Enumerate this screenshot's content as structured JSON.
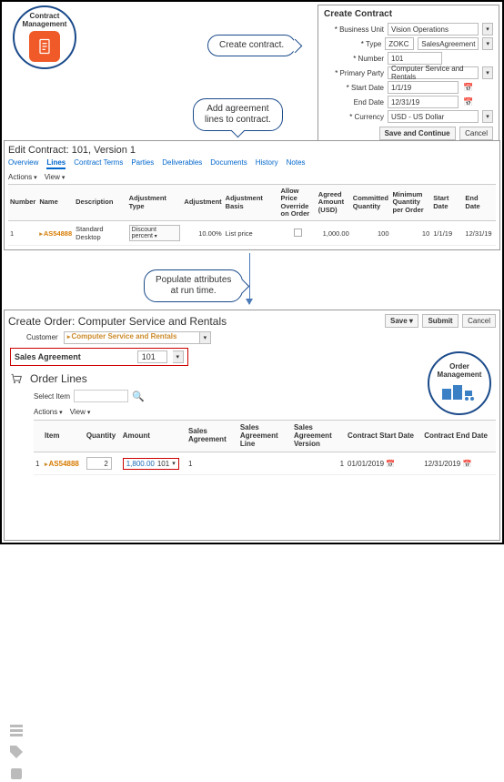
{
  "badges": {
    "contract_mgmt": "Contract Management",
    "order_mgmt": "Order Management"
  },
  "callouts": {
    "create": "Create contract.",
    "add_lines": "Add agreement\nlines to contract.",
    "populate": "Populate attributes\nat run time."
  },
  "dialog": {
    "title": "Create Contract",
    "fields": {
      "bu_label": "Business Unit",
      "bu_val": "Vision Operations",
      "type_label": "Type",
      "type_prefix": "ZOKC",
      "type_val": "SalesAgreement",
      "num_label": "Number",
      "num_val": "101",
      "pp_label": "Primary Party",
      "pp_val": "Computer Service and Rentals",
      "sd_label": "Start Date",
      "sd_val": "1/1/19",
      "ed_label": "End Date",
      "ed_val": "12/31/19",
      "cur_label": "Currency",
      "cur_val": "USD - US Dollar"
    },
    "save_btn": "Save and Continue",
    "cancel_btn": "Cancel"
  },
  "edit_panel": {
    "title": "Edit Contract: 101, Version 1",
    "tabs": [
      "Overview",
      "Lines",
      "Contract Terms",
      "Parties",
      "Deliverables",
      "Documents",
      "History",
      "Notes"
    ],
    "toolbar_actions": "Actions",
    "toolbar_view": "View",
    "cols": {
      "number": "Number",
      "name": "Name",
      "desc": "Description",
      "adjtype": "Adjustment Type",
      "adj": "Adjustment",
      "basis": "Adjustment Basis",
      "allow": "Allow Price Override on Order",
      "agreed": "Agreed Amount (USD)",
      "cqty": "Committed Quantity",
      "minqty": "Minimum Quantity per Order",
      "sdate": "Start Date",
      "edate": "End Date"
    },
    "row": {
      "number": "1",
      "name": "AS54888",
      "desc": "Standard Desktop",
      "adjtype": "Discount percent",
      "adj": "10.00%",
      "basis": "List price",
      "agreed": "1,000.00",
      "cqty": "100",
      "minqty": "10",
      "sdate": "1/1/19",
      "edate": "12/31/19"
    }
  },
  "order_panel": {
    "title": "Create Order: Computer Service and Rentals",
    "save": "Save",
    "submit": "Submit",
    "cancel": "Cancel",
    "cust_label": "Customer",
    "cust_val": "Computer Service and Rentals",
    "sa_label": "Sales Agreement",
    "sa_val": "101",
    "ol_header": "Order Lines",
    "select_label": "Select Item",
    "toolbar_actions": "Actions",
    "toolbar_view": "View",
    "cols": {
      "item": "Item",
      "qty": "Quantity",
      "amount": "Amount",
      "sa": "Sales Agreement",
      "sal": "Sales Agreement Line",
      "sav": "Sales Agreement Version",
      "csd": "Contract Start Date",
      "ced": "Contract End Date"
    },
    "row": {
      "num": "1",
      "item": "AS54888",
      "qty": "2",
      "amount": "1,800.00",
      "sa": "101",
      "sal": "1",
      "sav": "1",
      "csd": "01/01/2019",
      "ced": "12/31/2019"
    }
  }
}
